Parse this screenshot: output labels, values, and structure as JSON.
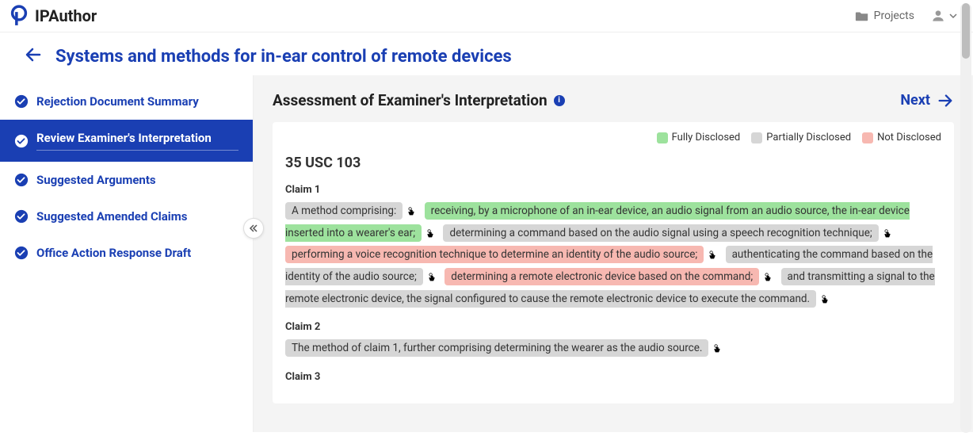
{
  "app": {
    "name": "IPAuthor"
  },
  "top": {
    "projects": "Projects"
  },
  "header": {
    "title": "Systems and methods for in-ear control of remote devices"
  },
  "sidebar": {
    "items": [
      {
        "label": "Rejection Document Summary"
      },
      {
        "label": "Review Examiner's Interpretation"
      },
      {
        "label": "Suggested Arguments"
      },
      {
        "label": "Suggested Amended Claims"
      },
      {
        "label": "Office Action Response Draft"
      }
    ],
    "activeIndex": 1
  },
  "panel": {
    "title": "Assessment of Examiner's Interpretation",
    "next": "Next"
  },
  "legend": {
    "full": "Fully Disclosed",
    "partial": "Partially Disclosed",
    "not": "Not Disclosed"
  },
  "statute": "35 USC 103",
  "claims": [
    {
      "label": "Claim 1",
      "segments": [
        {
          "text": "A method comprising:",
          "status": "partial"
        },
        {
          "text": "receiving, by a microphone of an in-ear device, an audio signal from an audio source, the in-ear device inserted into a wearer's ear;",
          "status": "full"
        },
        {
          "text": "determining a command based on the audio signal using a speech recognition technique;",
          "status": "partial"
        },
        {
          "text": "performing a voice recognition technique to determine an identity of the audio source;",
          "status": "not"
        },
        {
          "text": "authenticating the command based on the identity of the audio source;",
          "status": "partial"
        },
        {
          "text": "determining a remote electronic device based on the command;",
          "status": "not"
        },
        {
          "text": "and transmitting a signal to the remote electronic device, the signal configured to cause the remote electronic device to execute the command.",
          "status": "partial"
        }
      ]
    },
    {
      "label": "Claim 2",
      "segments": [
        {
          "text": "The method of claim 1, further comprising determining the wearer as the audio source.",
          "status": "partial"
        }
      ]
    },
    {
      "label": "Claim 3",
      "segments": []
    }
  ]
}
